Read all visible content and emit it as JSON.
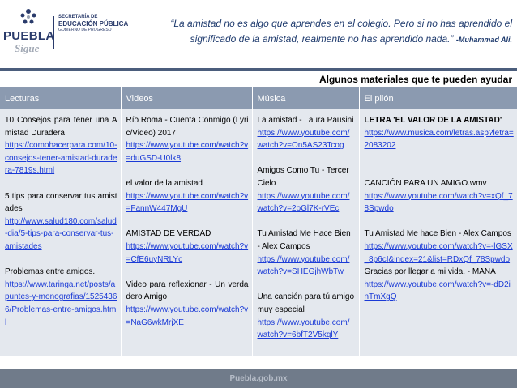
{
  "header": {
    "logo_main": "PUEBLA",
    "logo_sub": "Sigue",
    "sep_line1": "SECRETARÍA DE",
    "sep_line2": "EDUCACIÓN PÚBLICA",
    "sep_line3": "GOBIERNO DE PROGRESO",
    "quote": "“La amistad no es algo que aprendes en el colegio. Pero si no has aprendido el significado de la amistad, realmente no has aprendido nada.”",
    "author": "-Muhammad Ali."
  },
  "subtitle": "Algunos materiales que te pueden ayudar",
  "table": {
    "headers": [
      "Lecturas",
      "Videos",
      "Música",
      "El pilón"
    ],
    "lecturas": {
      "t1": "10 Consejos para tener una Amistad Duradera",
      "l1": "https://comohacerpara.com/10-consejos-tener-amistad-duradera-7819s.html",
      "t2": "5 tips para conservar tus amistades",
      "l2": "http://www.salud180.com/salud-dia/5-tips-para-conservar-tus-amistades",
      "t3": "Problemas entre amigos.",
      "l3": "https://www.taringa.net/posts/apuntes-y-monografias/15254366/Problemas-entre-amigos.html"
    },
    "videos": {
      "t1": "Río Roma - Cuenta Conmigo (Lyric/Video) 2017",
      "l1": "https://www.youtube.com/watch?v=duGSD-U0lk8",
      "t2": "el valor de la amistad",
      "l2": "https://www.youtube.com/watch?v=FannW447MgU",
      "t3": "AMISTAD DE VERDAD",
      "l3": "https://www.youtube.com/watch?v=CfE6uyNRLYc",
      "t4": "Video para reflexionar - Un verdadero Amigo",
      "l4": "https://www.youtube.com/watch?v=NaG6wkMrjXE"
    },
    "musica": {
      "t1": "La amistad - Laura Pausini",
      "l1": "https://www.youtube.com/watch?v=On5AS23Tcog",
      "t2": "Amigos Como Tu - Tercer Cielo",
      "l2": "https://www.youtube.com/watch?v=2oGl7K-rVEc",
      "t3": "Tu Amistad Me Hace Bien - Alex Campos",
      "l3": "https://www.youtube.com/watch?v=SHEGjhWbTw",
      "t4": "Una canción para tú amigo muy especial",
      "l4": "https://www.youtube.com/watch?v=6bfT2V5kqlY"
    },
    "pilon": {
      "t1": "LETRA 'EL VALOR DE LA AMISTAD'",
      "l1": "https://www.musica.com/letras.asp?letra=2083202",
      "t2": "CANCIÓN PARA UN AMIGO.wmv",
      "l2": "https://www.youtube.com/watch?v=xQf_78Spwdo",
      "t3": "Tu Amistad Me hace Bien - Alex Campos",
      "l3": "https://www.youtube.com/watch?v=-lGSX_8p6cI&index=21&list=RDxQf_78Spwdo",
      "t4": "Gracias por llegar a mi vida. - MANA",
      "l4": "https://www.youtube.com/watch?v=-dD2inTmXgQ"
    }
  },
  "footer": "Puebla.gob.mx"
}
